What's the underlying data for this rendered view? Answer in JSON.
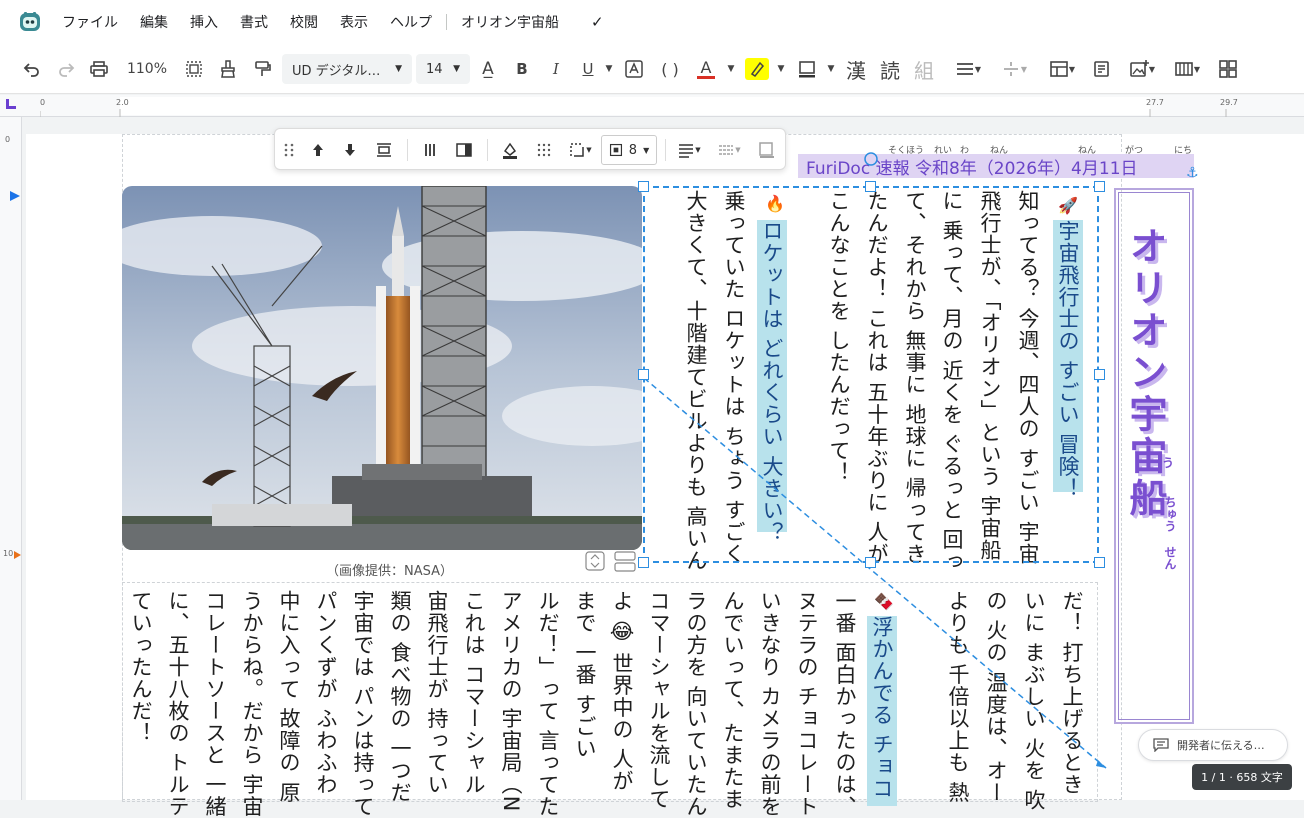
{
  "menu": {
    "items": [
      "ファイル",
      "編集",
      "挿入",
      "書式",
      "校閲",
      "表示",
      "ヘルプ"
    ],
    "doc_title": "オリオン宇宙船"
  },
  "toolbar": {
    "zoom": "110%",
    "font": "UD デジタル…",
    "font_size": "14",
    "kanji_label": "漢",
    "read_label": "読",
    "kumi_label": "組"
  },
  "ruler": {
    "h_ticks": [
      "0",
      "2.0",
      "27.7",
      "29.7"
    ],
    "v_ticks": [
      "0",
      "10"
    ]
  },
  "float_toolbar": {
    "spacing_value": "8"
  },
  "article": {
    "banner": "FuriDoc 速報 令和8年（2026年）4月11日",
    "banner_ruby": [
      "そくほう",
      "れい",
      "わ",
      "ねん",
      "ねん",
      "がつ",
      "にち"
    ],
    "title": "オリオン宇宙船",
    "title_ruby": [
      "う",
      "ちゅう",
      "せん"
    ],
    "caption": "（画像提供：NASA）",
    "heading1": "宇宙飛行士の すごい 冒険！",
    "col1": "知ってる？ 今週、四人の すごい 宇宙",
    "col2": "飛行士が、「オリオン」という 宇宙船",
    "col3": "に 乗って、月の 近くを ぐるっと 回っ",
    "col4": "て、それから 無事に 地球に 帰ってき",
    "col5": "たんだよ！ これは 五十年ぶりに 人が",
    "col6": "こんなことを したんだって！",
    "heading2": "ロケットは どれくらい 大きい？",
    "col7": "乗っていた ロケットは ちょう すごく",
    "col8": "大きくて、十階建てビルよりも 高いん",
    "lower_cols": [
      "だ！ 打ち上げるとき",
      "いに まぶしい 火を 吹",
      "の 火の 温度は、オー",
      "よりも 千倍以上も 熱"
    ],
    "heading3": "浮かんでる チョコ",
    "lower_cols2": [
      "一番 面白かったのは、",
      "ヌテラの チョコレート",
      "いきなり カメラの前を",
      "んでいって、たまたま",
      "ラの方を 向いていたん",
      "コマーシャルを流して",
      "よ 😂 世界中の 人が",
      "まで 一番 すごい",
      "ルだ！」って 言ってた",
      "アメリカの 宇宙局（N",
      "これは コマーシャル",
      "宙飛行士が 持ってい",
      "類の 食べ物の 一つだ",
      "宇宙では パンは持って",
      "パンくずが ふわふわ",
      "中に入って 故障の 原",
      "うからね。だから 宇宙",
      "コレートソースと 一緒",
      "に、五十八枚の トルテ",
      "ていったんだ！"
    ]
  },
  "feedback_label": "開発者に伝える…",
  "status": "1 / 1 · 658 文字"
}
